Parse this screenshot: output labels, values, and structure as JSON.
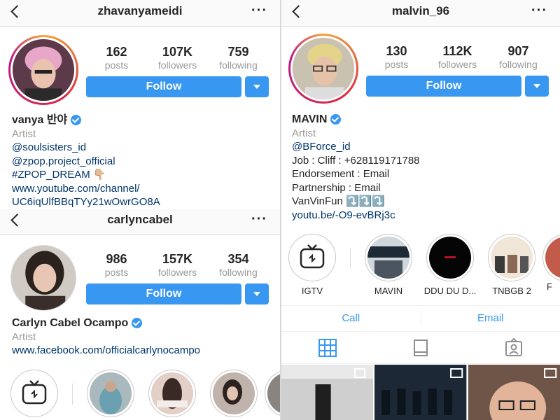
{
  "profiles": {
    "vanya": {
      "username": "zhavanyameidi",
      "posts": "162",
      "posts_label": "posts",
      "followers": "107K",
      "followers_label": "followers",
      "following": "759",
      "following_label": "following",
      "follow_label": "Follow",
      "display_name": "vanya 반야",
      "category": "Artist",
      "bio": [
        "@soulsisters_id",
        "@zpop.project_official",
        "#ZPOP_DREAM 👇🏼",
        "www.youtube.com/channel/",
        "UC6iqUlfBBqTYy21wOwrGO8A"
      ]
    },
    "malvin": {
      "username": "malvin_96",
      "posts": "130",
      "posts_label": "posts",
      "followers": "112K",
      "followers_label": "followers",
      "following": "907",
      "following_label": "following",
      "follow_label": "Follow",
      "display_name": "MAVIN",
      "category": "Artist",
      "bio": [
        "@BForce_id",
        "Job : Cliff : +628119171788",
        "Endorsement : Email",
        "Partnership : Email",
        "VanVinFun ⤵️⤵️⤵️",
        "youtu.be/-O9-evBRj3c"
      ],
      "highlights": [
        "IGTV",
        "MAVIN",
        "DDU DU D...",
        "TNBGB 2",
        "F"
      ],
      "contact": {
        "call": "Call",
        "email": "Email"
      }
    },
    "carlyn": {
      "username": "carlyncabel",
      "posts": "986",
      "posts_label": "posts",
      "followers": "157K",
      "followers_label": "followers",
      "following": "354",
      "following_label": "following",
      "follow_label": "Follow",
      "display_name": "Carlyn Cabel Ocampo",
      "category": "Artist",
      "bio": [
        "www.facebook.com/officialcarlynocampo"
      ]
    }
  },
  "colors": {
    "accent": "#3897f0",
    "link": "#003569",
    "muted": "#999999"
  },
  "icons": [
    "back-arrow-icon",
    "more-icon",
    "verified-icon",
    "dropdown-icon",
    "grid-icon",
    "igtv-icon",
    "tagged-icon"
  ]
}
